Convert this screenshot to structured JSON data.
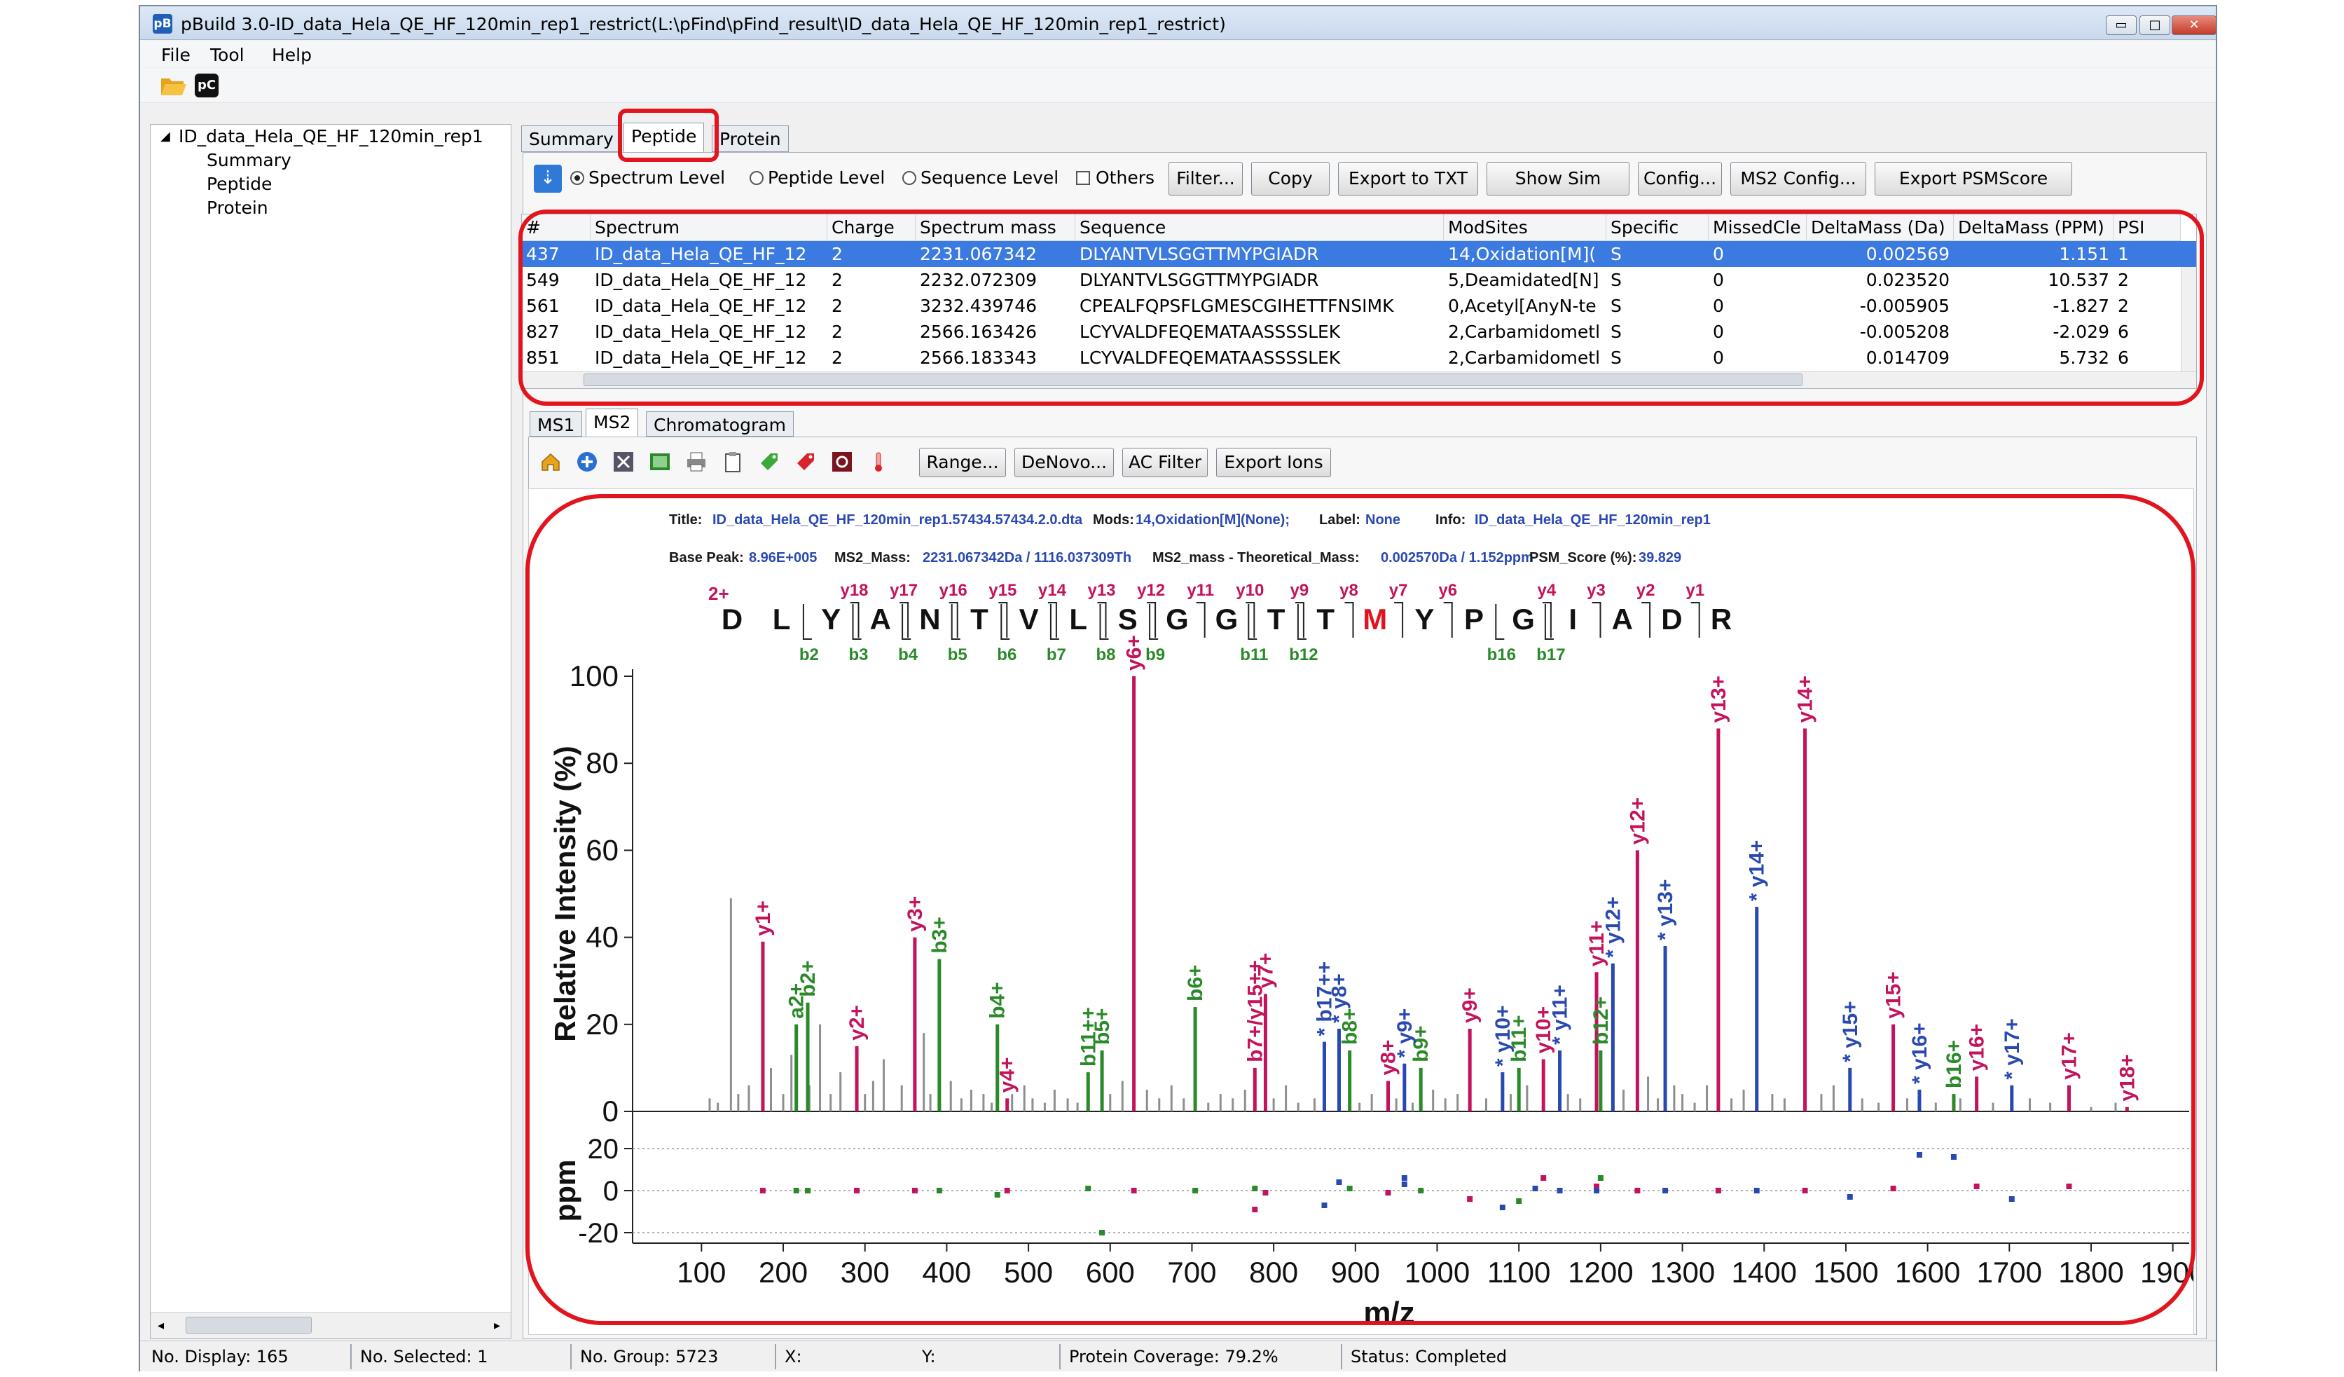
{
  "window": {
    "title": "pBuild 3.0-ID_data_Hela_QE_HF_120min_rep1_restrict(L:\\pFind\\pFind_result\\ID_data_Hela_QE_HF_120min_rep1_restrict)",
    "icon_text": "pB",
    "min": "▭",
    "max": "□",
    "close": "✕"
  },
  "menu": [
    "File",
    "Tool",
    "Help"
  ],
  "toolbar": {
    "open_icon": "folder-open-icon",
    "pc_icon": "pC",
    "pc_label": "pC"
  },
  "tree": {
    "root": "ID_data_Hela_QE_HF_120min_rep1",
    "items": [
      "Summary",
      "Peptide",
      "Protein"
    ]
  },
  "tabs": [
    "Summary",
    "Peptide",
    "Protein"
  ],
  "peptide_toolbar": {
    "levels": [
      "Spectrum Level",
      "Peptide Level",
      "Sequence Level"
    ],
    "others": "Others",
    "buttons": [
      "Filter...",
      "Copy",
      "Export to TXT",
      "Show Sim",
      "Config...",
      "MS2 Config...",
      "Export PSMScore"
    ]
  },
  "table": {
    "columns": [
      "#",
      "Spectrum",
      "Charge",
      "Spectrum mass",
      "Sequence",
      "ModSites",
      "Specific",
      "MissedCle",
      "DeltaMass (Da)",
      "DeltaMass (PPM)",
      "PSI"
    ],
    "rows": [
      [
        "437",
        "ID_data_Hela_QE_HF_12",
        "2",
        "2231.067342",
        "DLYANTVLSGGTTMYPGIADR",
        "14,Oxidation[M](",
        "S",
        "0",
        "0.002569",
        "1.151",
        "1"
      ],
      [
        "549",
        "ID_data_Hela_QE_HF_12",
        "2",
        "2232.072309",
        "DLYANTVLSGGTTMYPGIADR",
        "5,Deamidated[N]",
        "S",
        "0",
        "0.023520",
        "10.537",
        "2"
      ],
      [
        "561",
        "ID_data_Hela_QE_HF_12",
        "2",
        "3232.439746",
        "CPEALFQPSFLGMESCGIHETTFNSIMK",
        "0,Acetyl[AnyN-te",
        "S",
        "0",
        "-0.005905",
        "-1.827",
        "2"
      ],
      [
        "827",
        "ID_data_Hela_QE_HF_12",
        "2",
        "2566.163426",
        "LCYVALDFEQEMATAASSSSLEK",
        "2,Carbamidometl",
        "S",
        "0",
        "-0.005208",
        "-2.029",
        "6"
      ],
      [
        "851",
        "ID_data_Hela_QE_HF_12",
        "2",
        "2566.183343",
        "LCYVALDFEQEMATAASSSSLEK",
        "2,Carbamidometl",
        "S",
        "0",
        "0.014709",
        "5.732",
        "6"
      ]
    ]
  },
  "sub_tabs": [
    "MS1",
    "MS2",
    "Chromatogram"
  ],
  "ms2_toolbar": {
    "icons": [
      "home-icon",
      "plus-icon",
      "tools-icon",
      "image-icon",
      "print-icon",
      "clipboard-icon",
      "green-tag-icon",
      "red-tag-icon",
      "settings-icon",
      "thermometer-icon"
    ],
    "buttons": [
      "Range...",
      "DeNovo...",
      "AC Filter",
      "Export Ions"
    ]
  },
  "spectrum_info": {
    "title_label": "Title:",
    "title": "ID_data_Hela_QE_HF_120min_rep1.57434.57434.2.0.dta",
    "mods_label": "Mods:",
    "mods": "14,Oxidation[M](None);",
    "label_label": "Label:",
    "label": "None",
    "info_label": "Info:",
    "info": "ID_data_Hela_QE_HF_120min_rep1",
    "base_label": "Base Peak:",
    "base": "8.96E+005",
    "ms2mass_label": "MS2_Mass:",
    "ms2mass": "2231.067342Da / 1116.037309Th",
    "delta_label": "MS2_mass - Theoretical_Mass:",
    "delta": "0.002570Da / 1.152ppm",
    "score_label": "PSM_Score (%):",
    "score": "39.829"
  },
  "peptide_map": {
    "charge": "2+",
    "sequence": [
      "D",
      "L",
      "Y",
      "A",
      "N",
      "T",
      "V",
      "L",
      "S",
      "G",
      "G",
      "T",
      "T",
      "M",
      "Y",
      "P",
      "G",
      "I",
      "A",
      "D",
      "R"
    ],
    "modified_index": 13,
    "y_labels": [
      "y18",
      "y17",
      "y16",
      "y15",
      "y14",
      "y13",
      "y12",
      "y11",
      "y10",
      "y9",
      "y8",
      "y7",
      "y6",
      "y4",
      "y3",
      "y2",
      "y1"
    ],
    "y_after": [
      3,
      4,
      5,
      6,
      7,
      8,
      9,
      10,
      11,
      12,
      13,
      14,
      15,
      17,
      18,
      19,
      20
    ],
    "b_labels": [
      "b2",
      "b3",
      "b4",
      "b5",
      "b6",
      "b7",
      "b8",
      "b9",
      "b11",
      "b12",
      "b16",
      "b17"
    ],
    "b_after": [
      2,
      3,
      4,
      5,
      6,
      7,
      8,
      9,
      11,
      12,
      16,
      17
    ]
  },
  "colors": {
    "y": "#c4135d",
    "b": "#2a8a2a",
    "star": "#2a49b0",
    "gray": "#8e8e8e",
    "dark": "#1e5a1e",
    "modified": "#e0141e",
    "highlight": "#e2141e",
    "selection": "#3b7ae0"
  },
  "chart_data": {
    "type": "bar",
    "xlabel": "m/z",
    "ylabel": "Relative Intensity (%)",
    "ylabel2": "ppm",
    "xlim": [
      50,
      1920
    ],
    "ylim": [
      0,
      100
    ],
    "ppm_lim": [
      -20,
      20
    ],
    "xticks": [
      100,
      200,
      300,
      400,
      500,
      600,
      700,
      800,
      900,
      1000,
      1100,
      1200,
      1300,
      1400,
      1500,
      1600,
      1700,
      1800,
      1900
    ],
    "yticks": [
      0,
      20,
      40,
      60,
      80,
      100
    ],
    "ppm_ticks": [
      20,
      0,
      -20
    ],
    "annotated_peaks": [
      {
        "mz": 175.1,
        "int": 39,
        "label": "y1+",
        "ion": "y"
      },
      {
        "mz": 230,
        "int": 25,
        "label": "b2+",
        "ion": "b"
      },
      {
        "mz": 216,
        "int": 20,
        "label": "a2+",
        "ion": "b"
      },
      {
        "mz": 290,
        "int": 15,
        "label": "y2+",
        "ion": "y"
      },
      {
        "mz": 361,
        "int": 40,
        "label": "y3+",
        "ion": "y"
      },
      {
        "mz": 391,
        "int": 35,
        "label": "b3+",
        "ion": "b"
      },
      {
        "mz": 474,
        "int": 3,
        "label": "y4+",
        "ion": "y"
      },
      {
        "mz": 462,
        "int": 20,
        "label": "b4+",
        "ion": "b"
      },
      {
        "mz": 573,
        "int": 9,
        "label": "b11++",
        "ion": "b"
      },
      {
        "mz": 590,
        "int": 14,
        "label": "b5+",
        "ion": "b"
      },
      {
        "mz": 629,
        "int": 100,
        "label": "y6+",
        "ion": "y"
      },
      {
        "mz": 777,
        "int": 10,
        "label": "b7+/y15++",
        "ion": "y"
      },
      {
        "mz": 790,
        "int": 27,
        "label": "y7+",
        "ion": "y"
      },
      {
        "mz": 704,
        "int": 24,
        "label": "b6+",
        "ion": "b"
      },
      {
        "mz": 862,
        "int": 16,
        "label": "b17++",
        "ion": "star"
      },
      {
        "mz": 880,
        "int": 19,
        "label": "y8+",
        "ion": "star"
      },
      {
        "mz": 940,
        "int": 7,
        "label": "y8+",
        "ion": "y"
      },
      {
        "mz": 893,
        "int": 14,
        "label": "b8+",
        "ion": "b"
      },
      {
        "mz": 980,
        "int": 10,
        "label": "b9+",
        "ion": "b"
      },
      {
        "mz": 960,
        "int": 11,
        "label": "y9+",
        "ion": "star"
      },
      {
        "mz": 1040,
        "int": 19,
        "label": "y9+",
        "ion": "y"
      },
      {
        "mz": 1080,
        "int": 9,
        "label": "y10+",
        "ion": "star"
      },
      {
        "mz": 1100,
        "int": 10,
        "label": "b11+",
        "ion": "b"
      },
      {
        "mz": 1130,
        "int": 12,
        "label": "y10+",
        "ion": "y"
      },
      {
        "mz": 1150,
        "int": 14,
        "label": "y11+",
        "ion": "star"
      },
      {
        "mz": 1195,
        "int": 32,
        "label": "y11+",
        "ion": "y"
      },
      {
        "mz": 1200,
        "int": 14,
        "label": "b12+",
        "ion": "b"
      },
      {
        "mz": 1215,
        "int": 34,
        "label": "y12+",
        "ion": "star"
      },
      {
        "mz": 1245,
        "int": 60,
        "label": "y12+",
        "ion": "y"
      },
      {
        "mz": 1279,
        "int": 38,
        "label": "y13+",
        "ion": "star"
      },
      {
        "mz": 1344,
        "int": 88,
        "label": "y13+",
        "ion": "y"
      },
      {
        "mz": 1391,
        "int": 47,
        "label": "y14+",
        "ion": "star"
      },
      {
        "mz": 1450,
        "int": 88,
        "label": "y14+",
        "ion": "y"
      },
      {
        "mz": 1505,
        "int": 10,
        "label": "y15+",
        "ion": "star"
      },
      {
        "mz": 1558,
        "int": 20,
        "label": "y15+",
        "ion": "y"
      },
      {
        "mz": 1590,
        "int": 5,
        "label": "y16+",
        "ion": "star"
      },
      {
        "mz": 1660,
        "int": 8,
        "label": "y16+",
        "ion": "y"
      },
      {
        "mz": 1632,
        "int": 4,
        "label": "b16+",
        "ion": "b"
      },
      {
        "mz": 1703,
        "int": 6,
        "label": "y17+",
        "ion": "star"
      },
      {
        "mz": 1773,
        "int": 6,
        "label": "y17+",
        "ion": "y"
      },
      {
        "mz": 1844,
        "int": 1,
        "label": "y18+",
        "ion": "y"
      }
    ],
    "unannotated_peaks": [
      [
        110,
        3
      ],
      [
        120,
        2
      ],
      [
        136,
        49
      ],
      [
        145,
        4
      ],
      [
        158,
        6
      ],
      [
        185,
        10
      ],
      [
        200,
        4
      ],
      [
        210,
        13
      ],
      [
        232,
        6
      ],
      [
        245,
        20
      ],
      [
        258,
        4
      ],
      [
        270,
        9
      ],
      [
        300,
        4
      ],
      [
        310,
        7
      ],
      [
        323,
        12
      ],
      [
        345,
        6
      ],
      [
        372,
        18
      ],
      [
        380,
        4
      ],
      [
        405,
        7
      ],
      [
        418,
        3
      ],
      [
        430,
        5
      ],
      [
        445,
        4
      ],
      [
        455,
        2
      ],
      [
        480,
        4
      ],
      [
        495,
        6
      ],
      [
        505,
        3
      ],
      [
        520,
        2
      ],
      [
        532,
        5
      ],
      [
        548,
        3
      ],
      [
        560,
        2
      ],
      [
        600,
        4
      ],
      [
        615,
        7
      ],
      [
        645,
        5
      ],
      [
        660,
        3
      ],
      [
        675,
        6
      ],
      [
        690,
        3
      ],
      [
        720,
        2
      ],
      [
        735,
        4
      ],
      [
        750,
        3
      ],
      [
        765,
        5
      ],
      [
        800,
        3
      ],
      [
        815,
        6
      ],
      [
        830,
        2
      ],
      [
        850,
        3
      ],
      [
        905,
        2
      ],
      [
        920,
        4
      ],
      [
        950,
        3
      ],
      [
        970,
        2
      ],
      [
        995,
        5
      ],
      [
        1010,
        3
      ],
      [
        1025,
        4
      ],
      [
        1060,
        3
      ],
      [
        1090,
        4
      ],
      [
        1110,
        6
      ],
      [
        1160,
        4
      ],
      [
        1175,
        3
      ],
      [
        1228,
        5
      ],
      [
        1258,
        8
      ],
      [
        1270,
        3
      ],
      [
        1290,
        6
      ],
      [
        1300,
        4
      ],
      [
        1315,
        2
      ],
      [
        1330,
        6
      ],
      [
        1360,
        3
      ],
      [
        1375,
        5
      ],
      [
        1410,
        4
      ],
      [
        1425,
        3
      ],
      [
        1470,
        4
      ],
      [
        1485,
        6
      ],
      [
        1520,
        3
      ],
      [
        1540,
        2
      ],
      [
        1575,
        3
      ],
      [
        1610,
        2
      ],
      [
        1640,
        3
      ],
      [
        1680,
        2
      ],
      [
        1725,
        3
      ],
      [
        1750,
        2
      ],
      [
        1800,
        1
      ],
      [
        1830,
        2
      ]
    ],
    "ppm_points": [
      [
        175,
        0,
        "y"
      ],
      [
        216,
        0,
        "b"
      ],
      [
        230,
        0,
        "b"
      ],
      [
        290,
        0,
        "y"
      ],
      [
        361,
        0,
        "y"
      ],
      [
        391,
        0,
        "b"
      ],
      [
        462,
        -2,
        "b"
      ],
      [
        474,
        0,
        "y"
      ],
      [
        573,
        1,
        "b"
      ],
      [
        590,
        -20,
        "b"
      ],
      [
        629,
        0,
        "y"
      ],
      [
        704,
        0,
        "b"
      ],
      [
        777,
        1,
        "b"
      ],
      [
        777,
        -9,
        "y"
      ],
      [
        790,
        -1,
        "y"
      ],
      [
        862,
        -7,
        "star"
      ],
      [
        880,
        4,
        "star"
      ],
      [
        893,
        1,
        "b"
      ],
      [
        940,
        -1,
        "y"
      ],
      [
        960,
        6,
        "star"
      ],
      [
        960,
        3,
        "star"
      ],
      [
        980,
        0,
        "b"
      ],
      [
        1040,
        -4,
        "y"
      ],
      [
        1080,
        -8,
        "star"
      ],
      [
        1100,
        -5,
        "b"
      ],
      [
        1120,
        1,
        "star"
      ],
      [
        1130,
        6,
        "y"
      ],
      [
        1150,
        0,
        "star"
      ],
      [
        1195,
        2,
        "y"
      ],
      [
        1195,
        0,
        "star"
      ],
      [
        1200,
        6,
        "b"
      ],
      [
        1245,
        0,
        "y"
      ],
      [
        1279,
        0,
        "star"
      ],
      [
        1344,
        0,
        "y"
      ],
      [
        1391,
        0,
        "star"
      ],
      [
        1450,
        0,
        "y"
      ],
      [
        1505,
        -3,
        "star"
      ],
      [
        1558,
        1,
        "y"
      ],
      [
        1590,
        17,
        "star"
      ],
      [
        1632,
        16,
        "star"
      ],
      [
        1660,
        2,
        "y"
      ],
      [
        1703,
        -4,
        "star"
      ],
      [
        1773,
        2,
        "y"
      ]
    ]
  },
  "status": {
    "display": "No. Display: 165",
    "selected": "No. Selected: 1",
    "group": "No. Group: 5723",
    "x": "X:",
    "y": "Y:",
    "coverage": "Protein Coverage: 79.2%",
    "status": "Status: Completed"
  }
}
